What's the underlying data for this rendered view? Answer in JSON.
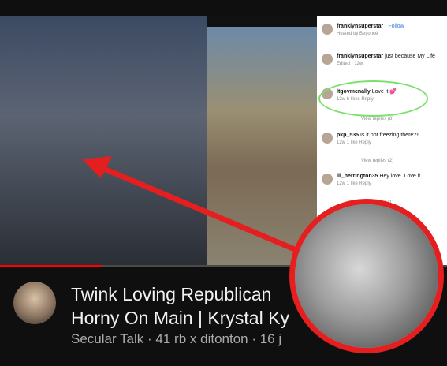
{
  "thumbnail": {
    "comments": [
      {
        "user": "franklynsuperstar",
        "text": "",
        "follow_label": "Follow",
        "subtext": "Heated by Beyoncé"
      },
      {
        "user": "franklynsuperstar",
        "text": "just because My Life",
        "meta": "Edited · 12w"
      },
      {
        "user": "ltgovmcnally",
        "text": "Love it 💕",
        "meta": "12w   6 likes   Reply",
        "replies": "View replies (8)"
      },
      {
        "user": "pkp_535",
        "text": "Is it not freezing there?!!",
        "meta": "12w   1 like   Reply",
        "replies": "View replies (2)"
      },
      {
        "user": "lil_herrington35",
        "text": "Hey love. Love it..",
        "meta": "12w   1 like   Reply",
        "replies": "View replies (1)"
      }
    ],
    "progress_fraction": 0.23
  },
  "video": {
    "title_line1": "Twink Loving Republican",
    "title_line2": "Horny On Main | Krystal Ky",
    "channel": "Secular Talk",
    "stats": "· 41 rb x ditonton · 16 j"
  },
  "colors": {
    "highlight_ring": "#7be06b",
    "annotation": "#e51f1f",
    "progress": "#ff0000"
  }
}
